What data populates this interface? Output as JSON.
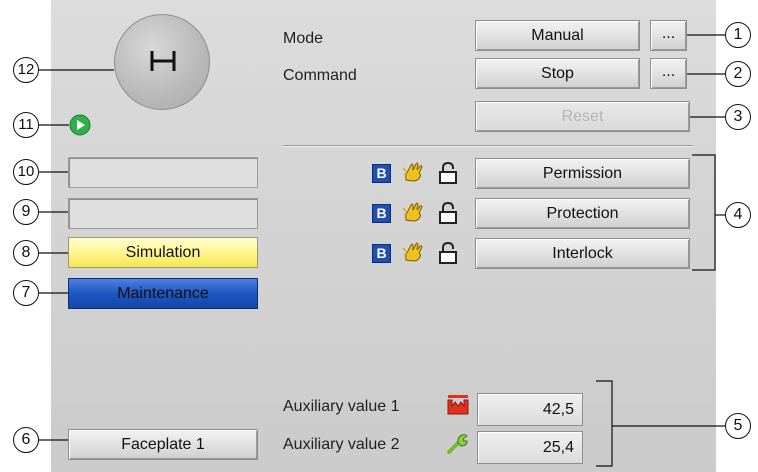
{
  "faceplate": {
    "mode_label": "Mode",
    "mode_value": "Manual",
    "command_label": "Command",
    "command_value": "Stop",
    "more_button": "...",
    "reset_label": "Reset",
    "interlocks": [
      {
        "label": "Permission",
        "badge": "B"
      },
      {
        "label": "Protection",
        "badge": "B"
      },
      {
        "label": "Interlock",
        "badge": "B"
      }
    ],
    "simulation_label": "Simulation",
    "maintenance_label": "Maintenance",
    "auxiliary": [
      {
        "label": "Auxiliary value 1",
        "value": "42,5",
        "icon": "process-value-icon"
      },
      {
        "label": "Auxiliary value 2",
        "value": "25,4",
        "icon": "wrench-icon"
      }
    ],
    "faceplate_button": "Faceplate 1"
  },
  "callouts": [
    "1",
    "2",
    "3",
    "4",
    "5",
    "6",
    "7",
    "8",
    "9",
    "10",
    "11",
    "12"
  ],
  "colors": {
    "simulation_bg": "#fff799",
    "maintenance_bg": "#1e55c0",
    "run_indicator": "#2fb14a",
    "badge_blue": "#1f4fb0"
  }
}
